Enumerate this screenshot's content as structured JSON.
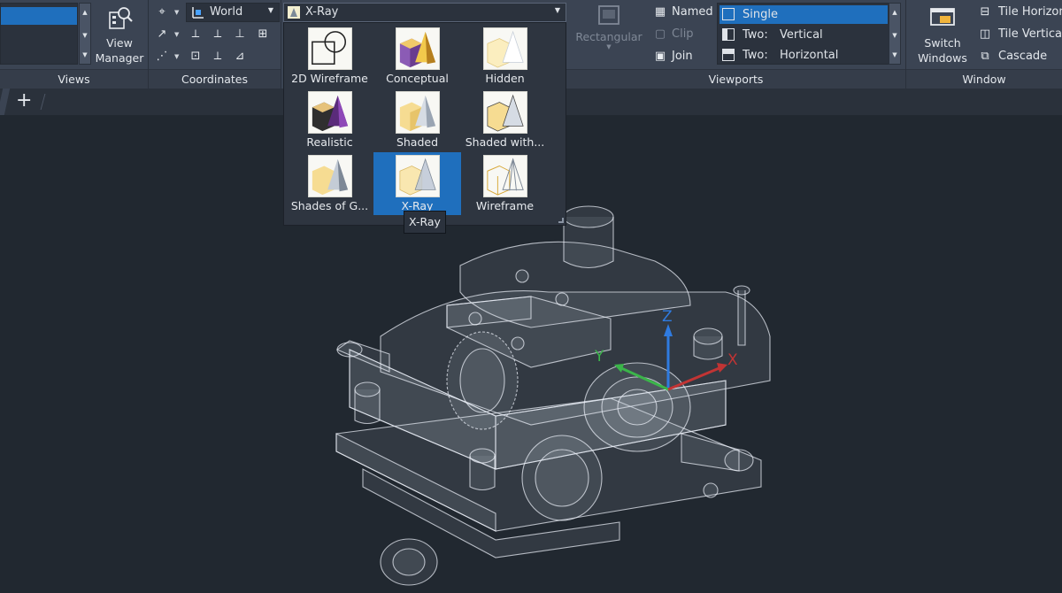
{
  "ribbon": {
    "views": {
      "title": "Views",
      "view_manager": [
        "View",
        "Manager"
      ]
    },
    "coordinates": {
      "title": "Coordinates",
      "ucs_value": "World"
    },
    "visual_styles": {
      "current": "X-Ray",
      "items": [
        {
          "label": "2D Wireframe"
        },
        {
          "label": "Conceptual"
        },
        {
          "label": "Hidden"
        },
        {
          "label": "Realistic"
        },
        {
          "label": "Shaded"
        },
        {
          "label": "Shaded with..."
        },
        {
          "label": "Shades of G..."
        },
        {
          "label": "X-Ray"
        },
        {
          "label": "Wireframe"
        }
      ],
      "tooltip": "X-Ray"
    },
    "viewports": {
      "title": "Viewports",
      "rectangular": "Rectangular",
      "named": "Named",
      "clip": "Clip",
      "join": "Join",
      "configs": [
        {
          "a": "Single",
          "b": ""
        },
        {
          "a": "Two:",
          "b": "Vertical"
        },
        {
          "a": "Two:",
          "b": "Horizontal"
        }
      ]
    },
    "window": {
      "title": "Window",
      "switch": [
        "Switch",
        "Windows"
      ],
      "tile_horizontal": "Tile Horizon",
      "tile_vertical": "Tile Vertical",
      "cascade": "Cascade"
    }
  },
  "tabs": {
    "new_tab": "+"
  },
  "ucs_axes": {
    "z": "Z",
    "y": "Y",
    "x": "X"
  },
  "colors": {
    "ribbon": "#3b4453",
    "canvas": "#212830",
    "selection": "#1f6fbd"
  }
}
